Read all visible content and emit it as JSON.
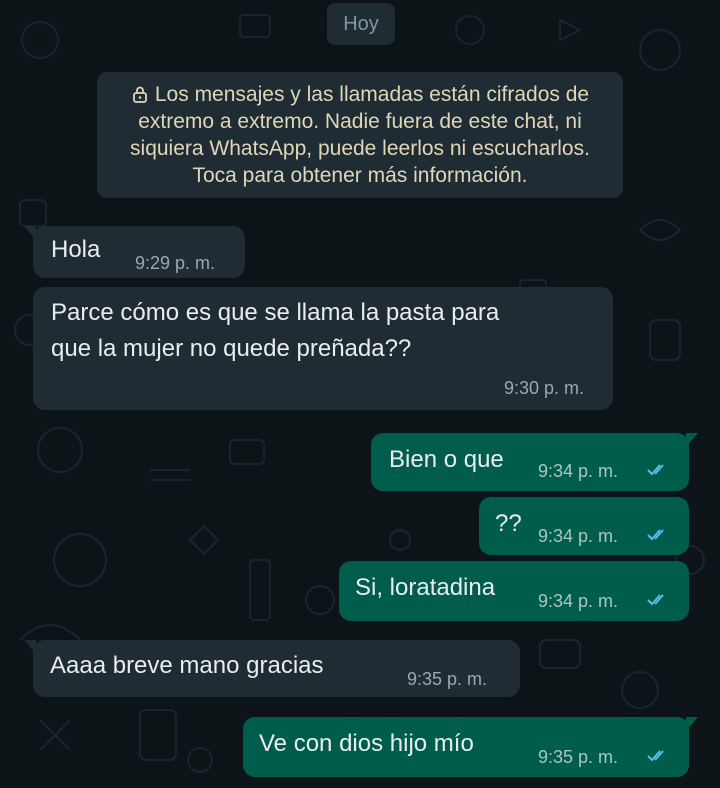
{
  "date_chip": "Hoy",
  "encryption_notice": {
    "lines": [
      "Los mensajes y las llamadas están cifrados de",
      "extremo a extremo. Nadie fuera de este chat, ni",
      "siquiera WhatsApp, puede leerlos ni escucharlos.",
      "Toca para obtener más información."
    ]
  },
  "messages": [
    {
      "direction": "incoming",
      "lines": [
        "Hola"
      ],
      "time": "9:29 p. m."
    },
    {
      "direction": "incoming",
      "lines": [
        "Parce cómo es que se llama la pasta para",
        "que la mujer no quede preñada??"
      ],
      "time": "9:30 p. m."
    },
    {
      "direction": "outgoing",
      "lines": [
        "Bien o que"
      ],
      "time": "9:34 p. m.",
      "status": "read"
    },
    {
      "direction": "outgoing",
      "lines": [
        "??"
      ],
      "time": "9:34 p. m.",
      "status": "read"
    },
    {
      "direction": "outgoing",
      "lines": [
        "Si, loratadina"
      ],
      "time": "9:34 p. m.",
      "status": "read"
    },
    {
      "direction": "incoming",
      "lines": [
        "Aaaa breve mano gracias"
      ],
      "time": "9:35 p. m."
    },
    {
      "direction": "outgoing",
      "lines": [
        "Ve con dios hijo mío"
      ],
      "time": "9:35 p. m.",
      "status": "read"
    }
  ],
  "colors": {
    "background": "#0d1418",
    "incoming_bubble": "#1f2c33",
    "outgoing_bubble": "#005c4b",
    "read_ticks": "#53bdeb"
  },
  "icons": {
    "notice": "lock-icon",
    "status": "double-check-icon"
  }
}
